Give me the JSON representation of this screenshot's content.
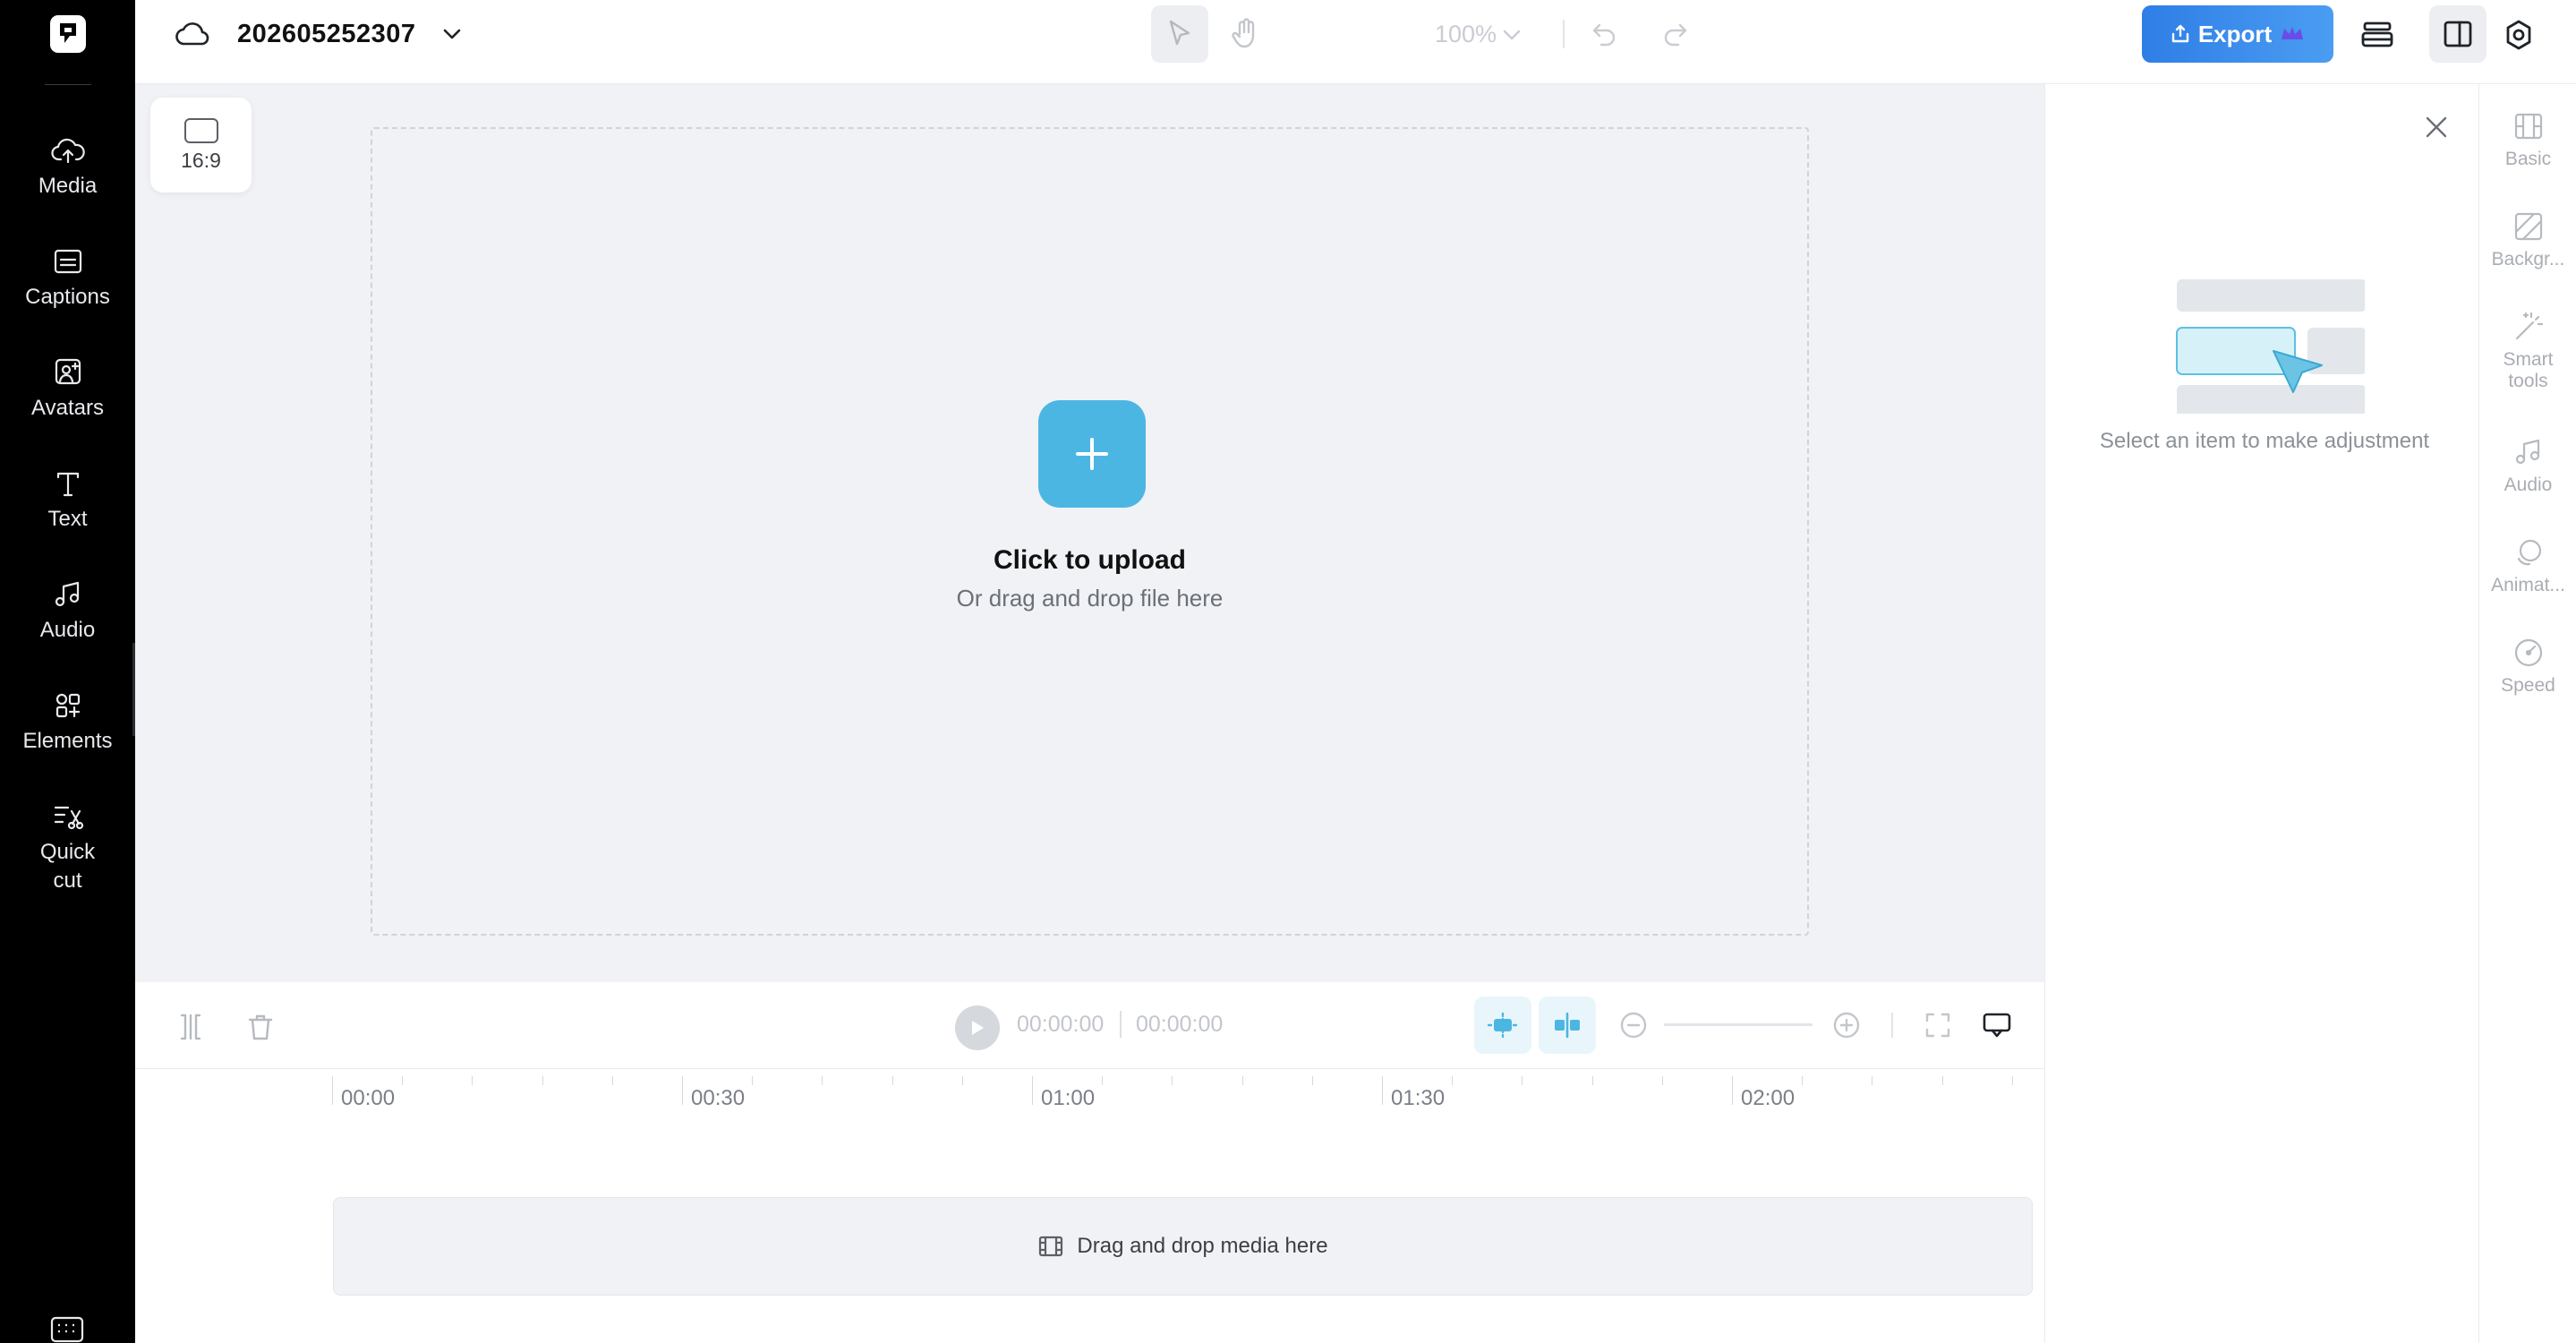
{
  "left_nav": {
    "items": [
      {
        "label": "Media",
        "icon": "cloud-upload-icon"
      },
      {
        "label": "Captions",
        "icon": "captions-icon"
      },
      {
        "label": "Avatars",
        "icon": "avatar-icon"
      },
      {
        "label": "Text",
        "icon": "text-icon"
      },
      {
        "label": "Audio",
        "icon": "music-note-icon"
      },
      {
        "label": "Elements",
        "icon": "elements-icon"
      },
      {
        "label": "Quick cut",
        "icon": "scissors-icon"
      }
    ]
  },
  "topbar": {
    "project_name": "202605252307",
    "zoom_level": "100%",
    "export_label": "Export"
  },
  "canvas": {
    "aspect_ratio": "16:9",
    "upload_title": "Click to upload",
    "upload_subtitle": "Or drag and drop file here"
  },
  "playback": {
    "current_time": "00:00:00",
    "total_time": "00:00:00"
  },
  "timeline": {
    "ruler_labels": [
      "00:00",
      "00:30",
      "01:00",
      "01:30",
      "02:00"
    ],
    "drop_label": "Drag and drop media here"
  },
  "properties": {
    "hint": "Select an item to make adjustment"
  },
  "tool_rail": {
    "items": [
      {
        "label": "Basic",
        "icon": "basic-icon"
      },
      {
        "label": "Backgr...",
        "icon": "background-icon"
      },
      {
        "label": "Smart tools",
        "icon": "magic-wand-icon"
      },
      {
        "label": "Audio",
        "icon": "music-note-icon"
      },
      {
        "label": "Animat...",
        "icon": "animation-icon"
      },
      {
        "label": "Speed",
        "icon": "speed-icon"
      }
    ]
  },
  "colors": {
    "accent": "#4cb6e3",
    "export_gradient_start": "#2f7ee6",
    "export_gradient_end": "#4a9df2",
    "sidebar_bg": "#000000",
    "canvas_bg": "#f0f2f5"
  }
}
